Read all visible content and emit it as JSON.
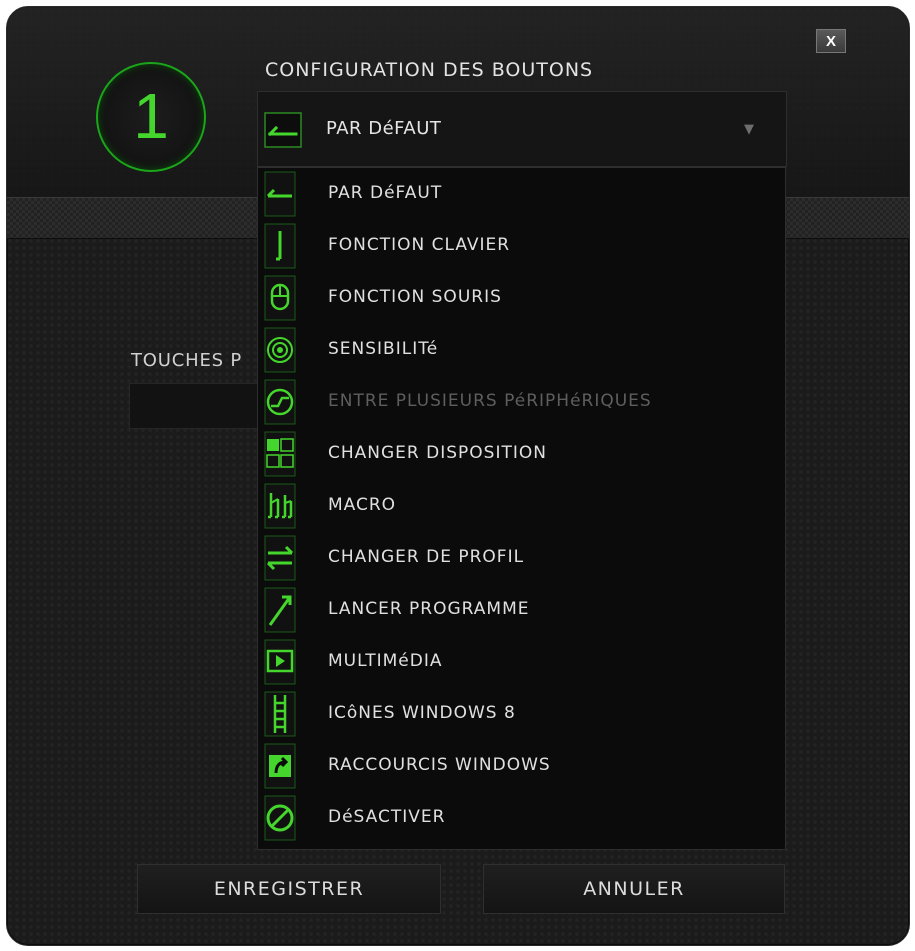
{
  "dialog": {
    "button_number": "1",
    "title": "CONFIGURATION DES BOUTONS",
    "close_label": "X"
  },
  "select": {
    "selected": "PAR DéFAUT"
  },
  "touches": {
    "label": "TOUCHES P"
  },
  "menu": {
    "items": [
      {
        "label": "PAR DéFAUT",
        "icon": "default-arrow-icon",
        "enabled": true
      },
      {
        "label": "FONCTION CLAVIER",
        "icon": "keyboard-key-icon",
        "enabled": true
      },
      {
        "label": "FONCTION SOURIS",
        "icon": "mouse-icon",
        "enabled": true
      },
      {
        "label": "SENSIBILITé",
        "icon": "sensitivity-target-icon",
        "enabled": true
      },
      {
        "label": "ENTRE PLUSIEURS PéRIPHéRIQUES",
        "icon": "inter-device-icon",
        "enabled": false
      },
      {
        "label": "CHANGER DISPOSITION",
        "icon": "layout-grid-icon",
        "enabled": true
      },
      {
        "label": "MACRO",
        "icon": "macro-icon",
        "enabled": true
      },
      {
        "label": "CHANGER DE PROFIL",
        "icon": "switch-profile-icon",
        "enabled": true
      },
      {
        "label": "LANCER PROGRAMME",
        "icon": "launch-program-icon",
        "enabled": true
      },
      {
        "label": "MULTIMéDIA",
        "icon": "multimedia-play-icon",
        "enabled": true
      },
      {
        "label": "ICôNES WINDOWS 8",
        "icon": "windows8-charms-icon",
        "enabled": true
      },
      {
        "label": "RACCOURCIS WINDOWS",
        "icon": "windows-shortcut-icon",
        "enabled": true
      },
      {
        "label": "DéSACTIVER",
        "icon": "disable-icon",
        "enabled": true
      }
    ]
  },
  "footer": {
    "save_label": "ENREGISTRER",
    "cancel_label": "ANNULER"
  },
  "colors": {
    "accent": "#44d62c",
    "background": "#1b1b1b",
    "menu_background": "#0b0b0b",
    "disabled_text": "#5e5e5e"
  }
}
